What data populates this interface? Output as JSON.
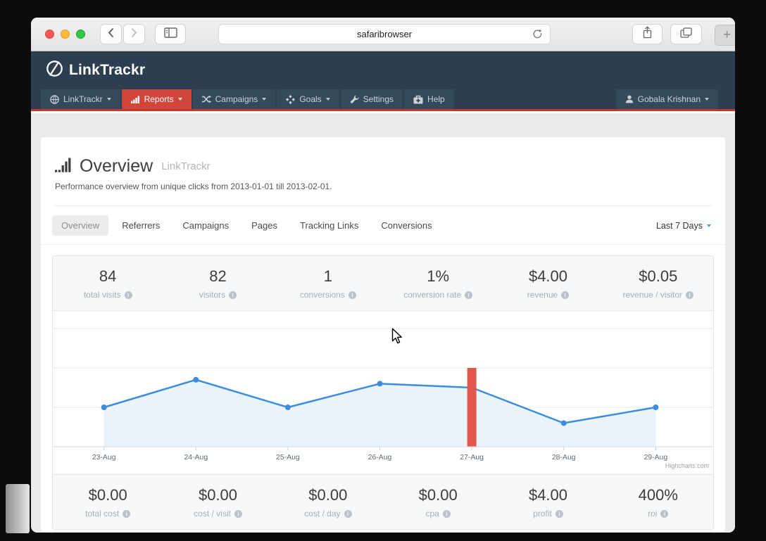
{
  "browser": {
    "url": "safaribrowser",
    "new_tab_label": "+"
  },
  "brand": {
    "name": "LinkTrackr"
  },
  "nav": {
    "items": [
      {
        "label": "LinkTrackr",
        "icon": "globe-icon",
        "caret": true,
        "active": false
      },
      {
        "label": "Reports",
        "icon": "bar-chart-icon",
        "caret": true,
        "active": true
      },
      {
        "label": "Campaigns",
        "icon": "shuffle-icon",
        "caret": true,
        "active": false
      },
      {
        "label": "Goals",
        "icon": "goals-icon",
        "caret": true,
        "active": false
      },
      {
        "label": "Settings",
        "icon": "wrench-icon",
        "caret": false,
        "active": false
      },
      {
        "label": "Help",
        "icon": "medkit-icon",
        "caret": false,
        "active": false
      }
    ],
    "user": {
      "label": "Gobala Krishnan",
      "icon": "user-icon",
      "caret": true
    }
  },
  "page": {
    "title": "Overview",
    "title_suffix": "LinkTrackr",
    "subtitle": "Performance overview from unique clicks from 2013-01-01 till 2013-02-01.",
    "tabs": [
      "Overview",
      "Referrers",
      "Campaigns",
      "Pages",
      "Tracking Links",
      "Conversions"
    ],
    "active_tab": "Overview",
    "date_range": "Last 7 Days"
  },
  "stats_top": [
    {
      "value": "84",
      "label": "total visits"
    },
    {
      "value": "82",
      "label": "visitors"
    },
    {
      "value": "1",
      "label": "conversions"
    },
    {
      "value": "1%",
      "label": "conversion rate"
    },
    {
      "value": "$4.00",
      "label": "revenue"
    },
    {
      "value": "$0.05",
      "label": "revenue / visitor"
    }
  ],
  "stats_bottom": [
    {
      "value": "$0.00",
      "label": "total cost"
    },
    {
      "value": "$0.00",
      "label": "cost / visit"
    },
    {
      "value": "$0.00",
      "label": "cost / day"
    },
    {
      "value": "$0.00",
      "label": "cpa"
    },
    {
      "value": "$4.00",
      "label": "profit"
    },
    {
      "value": "400%",
      "label": "roi"
    }
  ],
  "chart_data": {
    "type": "line",
    "x": [
      "23-Aug",
      "24-Aug",
      "25-Aug",
      "26-Aug",
      "27-Aug",
      "28-Aug",
      "29-Aug"
    ],
    "series": [
      {
        "name": "visits",
        "type": "area",
        "color": "#3b8ddd",
        "fill_color": "#eaf3fa",
        "values": [
          10,
          17,
          10,
          16,
          15,
          6,
          10
        ]
      },
      {
        "name": "conversion-marker",
        "type": "column",
        "color": "#e2574c",
        "values": [
          null,
          null,
          null,
          null,
          20,
          null,
          null
        ]
      }
    ],
    "ylim": [
      0,
      34
    ],
    "gridline_step": 10,
    "grid": true,
    "y_labels_visible": false,
    "legend": "none",
    "credit": "Highcharts.com"
  },
  "colors": {
    "header_bg": "#2d3e50",
    "nav_item_bg": "#35495c",
    "nav_active_bg": "#d2453a",
    "nav_underline": "#c0392b",
    "accent_blue": "#3b8ddd",
    "column_red": "#e2574c",
    "page_bg": "#e9ebeb",
    "panel_bg": "#f7f8f9"
  }
}
